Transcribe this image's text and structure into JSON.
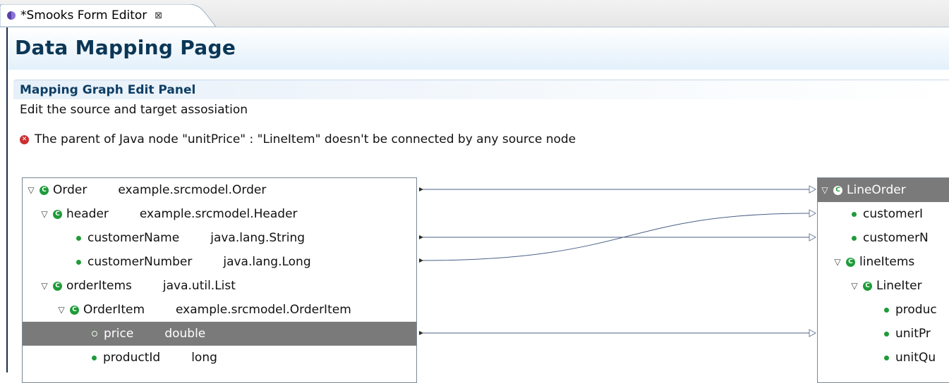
{
  "editor_tab": {
    "title": "*Smooks Form Editor",
    "close_symbol": "⊠",
    "icon": "smooks-editor-icon"
  },
  "page": {
    "title": "Data Mapping Page"
  },
  "section": {
    "title": "Mapping Graph Edit Panel",
    "description": "Edit the source and target assosiation",
    "error_message": "The parent of Java node \"unitPrice\" : \"LineItem\" doesn't be connected by any source node"
  },
  "source_tree": [
    {
      "name": "Order",
      "type": "example.srcmodel.Order"
    },
    {
      "name": "header",
      "type": "example.srcmodel.Header"
    },
    {
      "name": "customerName",
      "type": "java.lang.String"
    },
    {
      "name": "customerNumber",
      "type": "java.lang.Long"
    },
    {
      "name": "orderItems",
      "type": "java.util.List"
    },
    {
      "name": "OrderItem",
      "type": "example.srcmodel.OrderItem"
    },
    {
      "name": "price",
      "type": "double"
    },
    {
      "name": "productId",
      "type": "long"
    }
  ],
  "target_tree": [
    {
      "name": "LineOrder"
    },
    {
      "name": "customerI"
    },
    {
      "name": "customerN"
    },
    {
      "name": "lineItems"
    },
    {
      "name": "LineIter"
    },
    {
      "name": "produc"
    },
    {
      "name": "unitPr"
    },
    {
      "name": "unitQu"
    }
  ],
  "colors": {
    "accent": "#0b3757",
    "selection": "#7a7a7a",
    "class_icon": "#1f9b3a",
    "error": "#cc2f2f",
    "connection": "#4b5f86"
  }
}
